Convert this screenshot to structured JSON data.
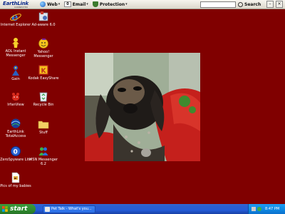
{
  "toolbar": {
    "brand": "EarthLink",
    "brand_sub": "CONNECTED",
    "web_label": "Web",
    "email_count": "0",
    "email_label": "Email",
    "protection_label": "Protection",
    "search_value": "",
    "search_label": "Search",
    "minimize_glyph": "–",
    "close_glyph": "×"
  },
  "desktop": {
    "icons_left": [
      {
        "label": "Internet Explorer",
        "icon": "internet-explorer-icon"
      },
      {
        "label": "AOL Instant Messenger",
        "icon": "aol-messenger-icon"
      },
      {
        "label": "Gain",
        "icon": "gain-icon"
      },
      {
        "label": "IrfanView",
        "icon": "irfanview-icon"
      },
      {
        "label": "EarthLink TotalAccess",
        "icon": "earthlink-icon"
      },
      {
        "label": "ZeroSpyware Lite",
        "icon": "zerospyware-icon"
      },
      {
        "label": "Pics of my babies",
        "icon": "document-icon"
      }
    ],
    "icons_right": [
      {
        "label": "Ad-aware 6.0",
        "icon": "adaware-icon"
      },
      {
        "label": "Yahoo! Messenger",
        "icon": "yahoo-messenger-icon"
      },
      {
        "label": "Kodak EasyShare",
        "icon": "kodak-icon"
      },
      {
        "label": "Recycle Bin",
        "icon": "recycle-bin-icon"
      },
      {
        "label": "Stuff",
        "icon": "folder-icon"
      },
      {
        "label": "MSN Messenger 6.2",
        "icon": "msn-messenger-icon"
      }
    ],
    "background_color": "#800000"
  },
  "taskbar": {
    "start_label": "start",
    "task_label": "Pet Talk - What's you...",
    "clock": "8:47 PM"
  },
  "colors": {
    "taskbar_blue": "#245dd9",
    "start_green": "#2f8b2f",
    "tray_blue": "#0f86e0"
  }
}
